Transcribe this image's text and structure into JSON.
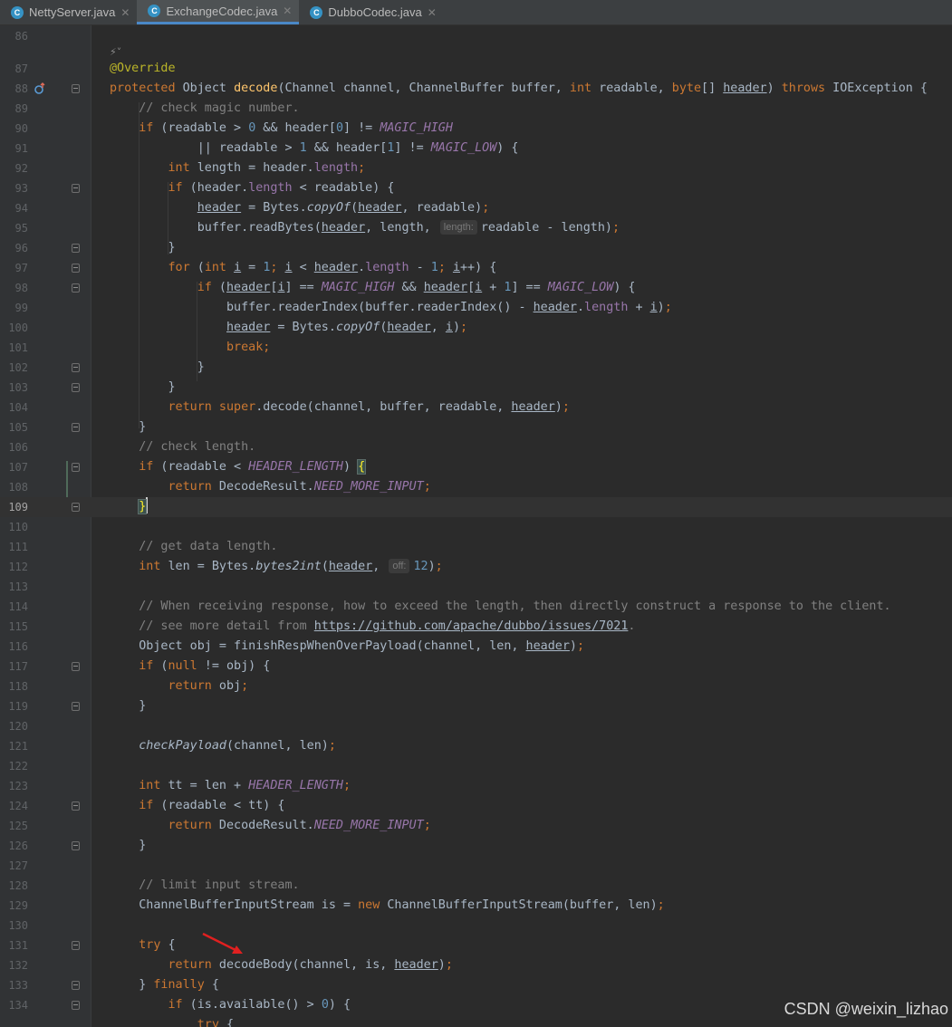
{
  "tabs": [
    {
      "label": "NettyServer.java",
      "icon": "C",
      "active": false
    },
    {
      "label": "ExchangeCodec.java",
      "icon": "C",
      "active": true
    },
    {
      "label": "DubboCodec.java",
      "icon": "C",
      "active": false
    }
  ],
  "lens_icon": "⚡˅",
  "line_numbers": [
    "86",
    "87",
    "88",
    "89",
    "90",
    "91",
    "92",
    "93",
    "94",
    "95",
    "96",
    "97",
    "98",
    "99",
    "100",
    "101",
    "102",
    "103",
    "104",
    "105",
    "106",
    "107",
    "108",
    "109",
    "110",
    "111",
    "112",
    "113",
    "114",
    "115",
    "116",
    "117",
    "118",
    "119",
    "120",
    "121",
    "122",
    "123",
    "124",
    "125",
    "126",
    "127",
    "128",
    "129",
    "130",
    "131",
    "132",
    "133",
    "134"
  ],
  "hints": {
    "length": "length:",
    "off": "off:"
  },
  "comments": {
    "magic": "// check magic number.",
    "check_length": "// check length.",
    "data_length": "// get data length.",
    "when_receiving": "// When receiving response, how to exceed the length, then directly construct a response to the client.",
    "see_more": "// see more detail from ",
    "issue_url": "https://github.com/apache/dubbo/issues/7021",
    "limit_input": "// limit input stream."
  },
  "watermark": "CSDN @weixin_lizhao"
}
